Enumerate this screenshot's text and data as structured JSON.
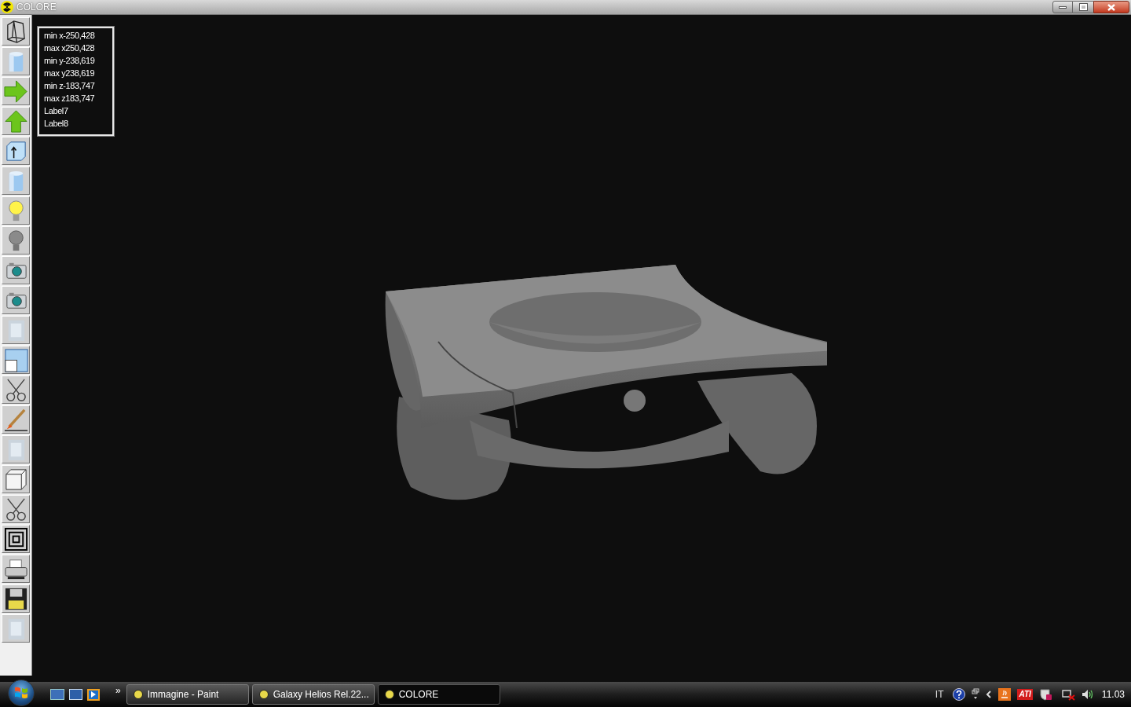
{
  "window": {
    "title": "COLORE"
  },
  "toolbar": [
    {
      "kind": "wireframe"
    },
    {
      "kind": "cylinder"
    },
    {
      "kind": "arrow-right"
    },
    {
      "kind": "arrow-up"
    },
    {
      "kind": "box-arrow"
    },
    {
      "kind": "cylinder"
    },
    {
      "kind": "bulb-on"
    },
    {
      "kind": "bulb-off"
    },
    {
      "kind": "camera"
    },
    {
      "kind": "camera"
    },
    {
      "kind": "texture"
    },
    {
      "kind": "window"
    },
    {
      "kind": "scissors"
    },
    {
      "kind": "brush"
    },
    {
      "kind": "texture"
    },
    {
      "kind": "cube"
    },
    {
      "kind": "scissors"
    },
    {
      "kind": "squares"
    },
    {
      "kind": "printer"
    },
    {
      "kind": "floppy"
    },
    {
      "kind": "texture"
    }
  ],
  "info_labels": [
    "min x-250,428",
    "max x250,428",
    "min y-238,619",
    "max y238,619",
    "min z-183,747",
    "max z183,747",
    "Label7",
    "Label8"
  ],
  "taskbar": {
    "quick_launch_more": "»",
    "tasks": [
      {
        "label": "Immagine - Paint",
        "selected": false
      },
      {
        "label": "Galaxy Helios  Rel.22...",
        "selected": false
      },
      {
        "label": "COLORE",
        "selected": true
      }
    ],
    "language": "IT",
    "tray_logo": "ATI",
    "clock": "11.03"
  }
}
